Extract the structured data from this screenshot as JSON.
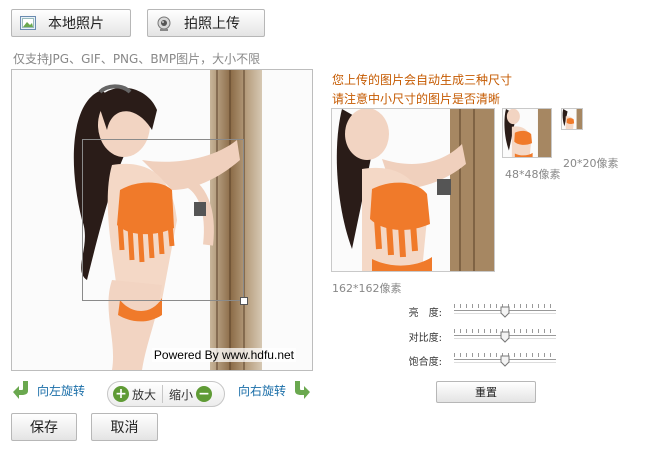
{
  "toolbar": {
    "local_label": "本地照片",
    "photo_label": "拍照上传"
  },
  "hint": "仅支持JPG、GIF、PNG、BMP图片，大小不限",
  "editor": {
    "powered": "Powered By www.hdfu.net"
  },
  "controls": {
    "rotate_left": "向左旋转",
    "zoom_in": "放大",
    "zoom_out": "缩小",
    "rotate_right": "向右旋转"
  },
  "actions": {
    "save": "保存",
    "cancel": "取消",
    "reset": "重置"
  },
  "preview": {
    "note1": "您上传的图片会自动生成三种尺寸",
    "note2": "请注意中小尺寸的图片是否清晰",
    "big_caption": "162*162像素",
    "mid_caption": "48*48像素",
    "small_caption": "20*20像素"
  },
  "adjust": {
    "brightness": {
      "label": "亮　度:",
      "value": 0.5
    },
    "contrast": {
      "label": "对比度:",
      "value": 0.5
    },
    "saturation": {
      "label": "饱合度:",
      "value": 0.5
    }
  },
  "colors": {
    "accent": "#c55a00",
    "link": "#1a6ea8",
    "bikini": "#f07a2a",
    "zoom_icon": "#5f9b35"
  }
}
